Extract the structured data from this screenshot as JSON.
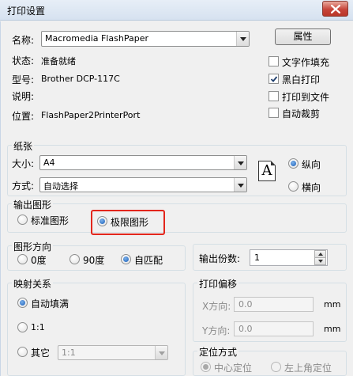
{
  "window": {
    "title": "打印设置"
  },
  "printer": {
    "name_label": "名称:",
    "name_value": "Macromedia FlashPaper",
    "properties_button": "属性",
    "status_label": "状态:",
    "status_value": "准备就绪",
    "type_label": "型号:",
    "type_value": "Brother DCP-117C",
    "comment_label": "说明:",
    "comment_value": "",
    "location_label": "位置:",
    "location_value": "FlashPaper2PrinterPort"
  },
  "options": {
    "text_fill": {
      "label": "文字作填充",
      "checked": false
    },
    "monochrome": {
      "label": "黑白打印",
      "checked": true
    },
    "print_to_file": {
      "label": "打印到文件",
      "checked": false
    },
    "auto_crop": {
      "label": "自动裁剪",
      "checked": false
    }
  },
  "paper": {
    "group_title": "纸张",
    "size_label": "大小:",
    "size_value": "A4",
    "source_label": "方式:",
    "source_value": "自动选择",
    "portrait": "纵向",
    "landscape": "横向",
    "selected_orientation": "portrait",
    "icon_letter": "A"
  },
  "output": {
    "group_title": "输出图形",
    "standard": "标准图形",
    "extents": "极限图形",
    "selected": "extents"
  },
  "direction": {
    "group_title": "图形方向",
    "deg0": "0度",
    "deg90": "90度",
    "auto": "自匹配",
    "selected": "auto"
  },
  "copies": {
    "label": "输出份数:",
    "value": "1"
  },
  "mapping": {
    "group_title": "映射关系",
    "fill": "自动填满",
    "one_to_one": "1:1",
    "other": "其它",
    "other_value": "1:1",
    "selected": "fill"
  },
  "offset": {
    "group_title": "打印偏移",
    "x_label": "X方向:",
    "x_value": "0.0",
    "y_label": "Y方向:",
    "y_value": "0.0",
    "unit": "mm"
  },
  "positioning": {
    "group_title": "定位方式",
    "center": "中心定位",
    "top_left": "左上角定位",
    "selected": "center"
  },
  "colors": {
    "highlight_border": "#e3261c",
    "radio_on": "#1b5fb8"
  }
}
